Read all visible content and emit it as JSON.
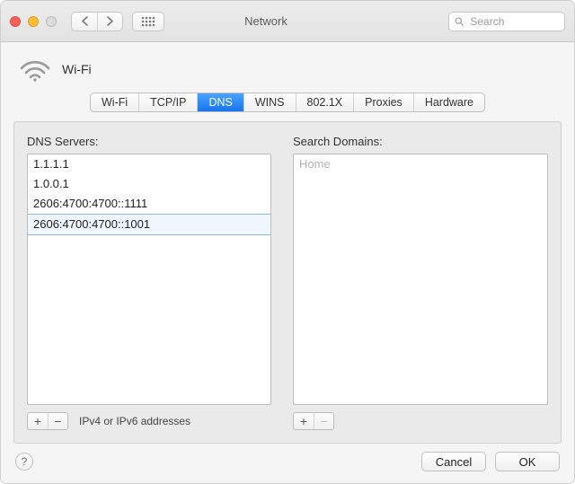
{
  "toolbar": {
    "title": "Network",
    "search_placeholder": "Search"
  },
  "header": {
    "connection": "Wi-Fi"
  },
  "tabs": [
    {
      "label": "Wi-Fi",
      "active": false
    },
    {
      "label": "TCP/IP",
      "active": false
    },
    {
      "label": "DNS",
      "active": true
    },
    {
      "label": "WINS",
      "active": false
    },
    {
      "label": "802.1X",
      "active": false
    },
    {
      "label": "Proxies",
      "active": false
    },
    {
      "label": "Hardware",
      "active": false
    }
  ],
  "dns": {
    "label": "DNS Servers:",
    "servers": [
      {
        "value": "1.1.1.1",
        "editing": false
      },
      {
        "value": "1.0.0.1",
        "editing": false
      },
      {
        "value": "2606:4700:4700::1111",
        "editing": false
      },
      {
        "value": "2606:4700:4700::1001",
        "editing": true
      }
    ],
    "add_label": "+",
    "remove_label": "−",
    "hint": "IPv4 or IPv6 addresses"
  },
  "search_domains": {
    "label": "Search Domains:",
    "items": [],
    "placeholder": "Home",
    "add_label": "+",
    "remove_label": "−",
    "remove_enabled": false
  },
  "footer": {
    "help": "?",
    "cancel": "Cancel",
    "ok": "OK"
  }
}
